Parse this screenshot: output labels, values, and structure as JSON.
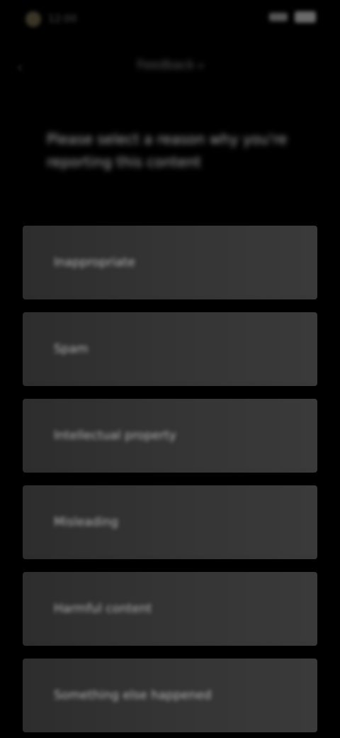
{
  "status_bar": {
    "time": "12:00",
    "icons": [
      "signal-icon",
      "battery-icon"
    ]
  },
  "header": {
    "back_icon": "back-arrow-icon",
    "title": "Feedback",
    "title_icon": "chevron-down-icon"
  },
  "prompt": {
    "text": "Please select a reason why you're reporting this content"
  },
  "options": [
    {
      "label": "Inappropriate"
    },
    {
      "label": "Spam"
    },
    {
      "label": "Intellectual property"
    },
    {
      "label": "Misleading"
    },
    {
      "label": "Harmful content"
    },
    {
      "label": "Something else happened"
    }
  ],
  "colors": {
    "background": "#000000",
    "option_background": "#333333",
    "text": "#b5b5b5"
  }
}
